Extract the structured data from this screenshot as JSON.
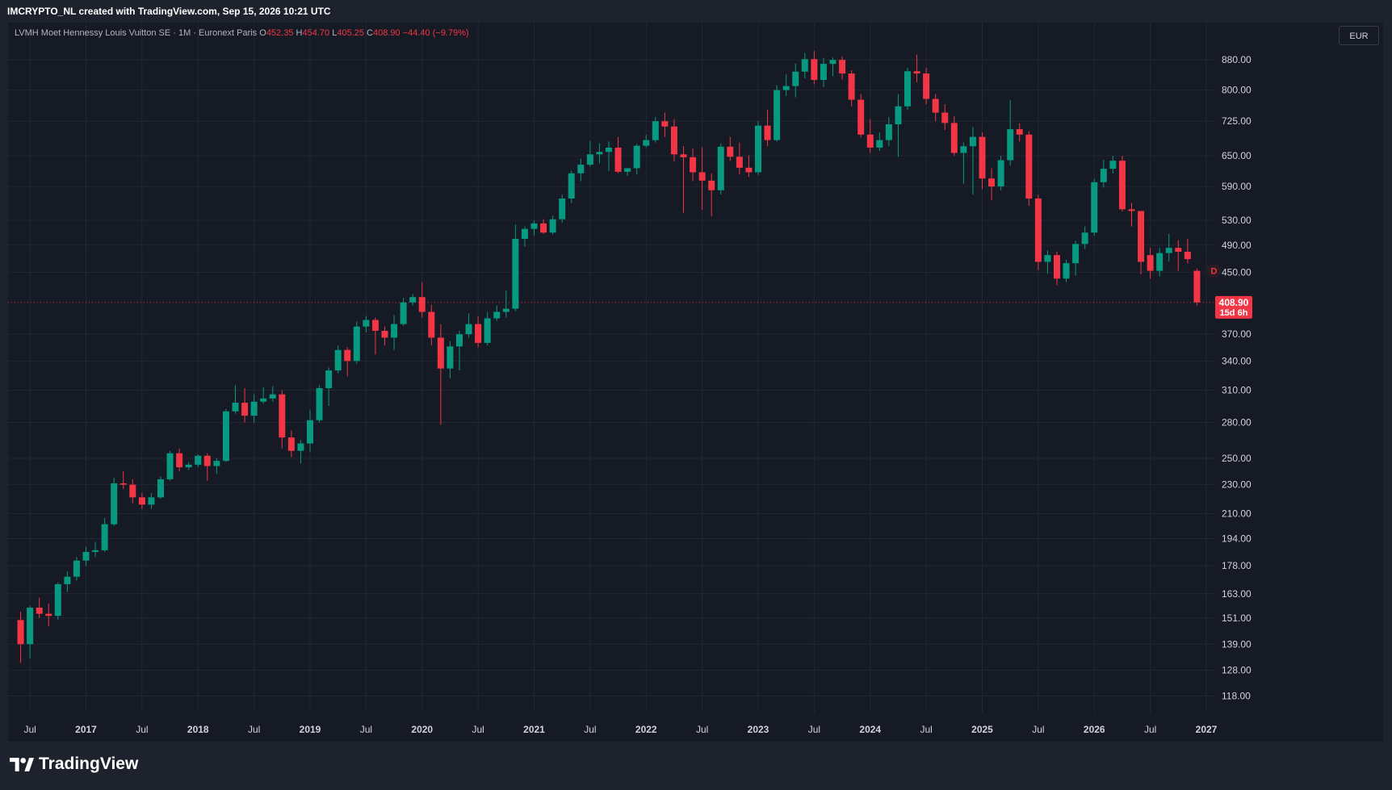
{
  "header": {
    "attribution": "IMCRYPTO_NL created with TradingView.com, Sep 15, 2026 10:21 UTC"
  },
  "legend": {
    "title": "LVMH Moet Hennessy Louis Vuitton SE · 1M · Euronext Paris",
    "o_label": "O",
    "o_value": "452.35",
    "h_label": "H",
    "h_value": "454.70",
    "l_label": "L",
    "l_value": "405.25",
    "c_label": "C",
    "c_value": "408.90",
    "change": "−44.40 (−9.79%)"
  },
  "currency_button": "EUR",
  "last_price": {
    "value": "408.90",
    "countdown": "15d 6h"
  },
  "event_marker": "D",
  "footer": {
    "logo_text": "TradingView"
  },
  "colors": {
    "up": "#089981",
    "down": "#f23645",
    "background": "#161a25",
    "grid": "#232733",
    "text": "#d1d4dc"
  },
  "chart_data": {
    "type": "candlestick",
    "title": "LVMH Moet Hennessy Louis Vuitton SE · 1M · Euronext Paris",
    "interval": "1M",
    "currency": "EUR",
    "y_scale": "log",
    "ylim": [
      112,
      990
    ],
    "x_range": [
      "2016-05",
      "2027-01"
    ],
    "y_ticks": [
      "880.00",
      "800.00",
      "725.00",
      "650.00",
      "590.00",
      "530.00",
      "490.00",
      "450.00",
      "370.00",
      "340.00",
      "310.00",
      "280.00",
      "250.00",
      "230.00",
      "210.00",
      "194.00",
      "178.00",
      "163.00",
      "151.00",
      "139.00",
      "128.00",
      "118.00"
    ],
    "x_ticks": [
      {
        "label": "Jul",
        "date": "2016-07"
      },
      {
        "label": "2017",
        "date": "2017-01"
      },
      {
        "label": "Jul",
        "date": "2017-07"
      },
      {
        "label": "2018",
        "date": "2018-01"
      },
      {
        "label": "Jul",
        "date": "2018-07"
      },
      {
        "label": "2019",
        "date": "2019-01"
      },
      {
        "label": "Jul",
        "date": "2019-07"
      },
      {
        "label": "2020",
        "date": "2020-01"
      },
      {
        "label": "Jul",
        "date": "2020-07"
      },
      {
        "label": "2021",
        "date": "2021-01"
      },
      {
        "label": "Jul",
        "date": "2021-07"
      },
      {
        "label": "2022",
        "date": "2022-01"
      },
      {
        "label": "Jul",
        "date": "2022-07"
      },
      {
        "label": "2023",
        "date": "2023-01"
      },
      {
        "label": "Jul",
        "date": "2023-07"
      },
      {
        "label": "2024",
        "date": "2024-01"
      },
      {
        "label": "Jul",
        "date": "2024-07"
      },
      {
        "label": "2025",
        "date": "2025-01"
      },
      {
        "label": "Jul",
        "date": "2025-07"
      },
      {
        "label": "2026",
        "date": "2026-01"
      },
      {
        "label": "Jul",
        "date": "2026-07"
      },
      {
        "label": "2027",
        "date": "2027-01"
      }
    ],
    "last_price": 408.9,
    "candles": [
      {
        "t": "2016-06",
        "o": 150,
        "h": 154,
        "l": 131,
        "c": 139
      },
      {
        "t": "2016-07",
        "o": 139,
        "h": 157,
        "l": 133,
        "c": 156
      },
      {
        "t": "2016-08",
        "o": 156,
        "h": 161,
        "l": 151,
        "c": 153
      },
      {
        "t": "2016-09",
        "o": 153,
        "h": 158,
        "l": 147,
        "c": 152
      },
      {
        "t": "2016-10",
        "o": 152,
        "h": 169,
        "l": 150,
        "c": 168
      },
      {
        "t": "2016-11",
        "o": 168,
        "h": 175,
        "l": 164,
        "c": 172
      },
      {
        "t": "2016-12",
        "o": 172,
        "h": 183,
        "l": 170,
        "c": 181
      },
      {
        "t": "2017-01",
        "o": 181,
        "h": 189,
        "l": 178,
        "c": 186
      },
      {
        "t": "2017-02",
        "o": 186,
        "h": 192,
        "l": 183,
        "c": 187
      },
      {
        "t": "2017-03",
        "o": 187,
        "h": 207,
        "l": 186,
        "c": 203
      },
      {
        "t": "2017-04",
        "o": 203,
        "h": 235,
        "l": 202,
        "c": 231
      },
      {
        "t": "2017-05",
        "o": 231,
        "h": 240,
        "l": 227,
        "c": 230
      },
      {
        "t": "2017-06",
        "o": 230,
        "h": 234,
        "l": 217,
        "c": 221
      },
      {
        "t": "2017-07",
        "o": 221,
        "h": 224,
        "l": 213,
        "c": 216
      },
      {
        "t": "2017-08",
        "o": 216,
        "h": 224,
        "l": 213,
        "c": 221
      },
      {
        "t": "2017-09",
        "o": 221,
        "h": 236,
        "l": 220,
        "c": 234
      },
      {
        "t": "2017-10",
        "o": 234,
        "h": 256,
        "l": 233,
        "c": 254
      },
      {
        "t": "2017-11",
        "o": 254,
        "h": 258,
        "l": 240,
        "c": 243
      },
      {
        "t": "2017-12",
        "o": 243,
        "h": 247,
        "l": 241,
        "c": 245
      },
      {
        "t": "2018-01",
        "o": 245,
        "h": 253,
        "l": 243,
        "c": 252
      },
      {
        "t": "2018-02",
        "o": 252,
        "h": 254,
        "l": 233,
        "c": 244
      },
      {
        "t": "2018-03",
        "o": 244,
        "h": 250,
        "l": 238,
        "c": 248
      },
      {
        "t": "2018-04",
        "o": 248,
        "h": 292,
        "l": 247,
        "c": 290
      },
      {
        "t": "2018-05",
        "o": 290,
        "h": 315,
        "l": 288,
        "c": 298
      },
      {
        "t": "2018-06",
        "o": 298,
        "h": 312,
        "l": 280,
        "c": 286
      },
      {
        "t": "2018-07",
        "o": 286,
        "h": 306,
        "l": 280,
        "c": 299
      },
      {
        "t": "2018-08",
        "o": 299,
        "h": 313,
        "l": 297,
        "c": 302
      },
      {
        "t": "2018-09",
        "o": 302,
        "h": 314,
        "l": 299,
        "c": 306
      },
      {
        "t": "2018-10",
        "o": 306,
        "h": 310,
        "l": 258,
        "c": 267
      },
      {
        "t": "2018-11",
        "o": 267,
        "h": 273,
        "l": 251,
        "c": 256
      },
      {
        "t": "2018-12",
        "o": 256,
        "h": 265,
        "l": 246,
        "c": 262
      },
      {
        "t": "2019-01",
        "o": 262,
        "h": 291,
        "l": 255,
        "c": 282
      },
      {
        "t": "2019-02",
        "o": 282,
        "h": 315,
        "l": 280,
        "c": 312
      },
      {
        "t": "2019-03",
        "o": 312,
        "h": 333,
        "l": 295,
        "c": 330
      },
      {
        "t": "2019-04",
        "o": 330,
        "h": 357,
        "l": 327,
        "c": 352
      },
      {
        "t": "2019-05",
        "o": 352,
        "h": 355,
        "l": 324,
        "c": 340
      },
      {
        "t": "2019-06",
        "o": 340,
        "h": 385,
        "l": 337,
        "c": 379
      },
      {
        "t": "2019-07",
        "o": 379,
        "h": 392,
        "l": 372,
        "c": 387
      },
      {
        "t": "2019-08",
        "o": 387,
        "h": 390,
        "l": 347,
        "c": 374
      },
      {
        "t": "2019-09",
        "o": 374,
        "h": 379,
        "l": 357,
        "c": 366
      },
      {
        "t": "2019-10",
        "o": 366,
        "h": 393,
        "l": 352,
        "c": 382
      },
      {
        "t": "2019-11",
        "o": 382,
        "h": 415,
        "l": 380,
        "c": 409
      },
      {
        "t": "2019-12",
        "o": 409,
        "h": 420,
        "l": 405,
        "c": 416
      },
      {
        "t": "2020-01",
        "o": 416,
        "h": 436,
        "l": 390,
        "c": 397
      },
      {
        "t": "2020-02",
        "o": 397,
        "h": 406,
        "l": 357,
        "c": 366
      },
      {
        "t": "2020-03",
        "o": 366,
        "h": 382,
        "l": 278,
        "c": 332
      },
      {
        "t": "2020-04",
        "o": 332,
        "h": 362,
        "l": 322,
        "c": 356
      },
      {
        "t": "2020-05",
        "o": 356,
        "h": 374,
        "l": 330,
        "c": 370
      },
      {
        "t": "2020-06",
        "o": 370,
        "h": 395,
        "l": 366,
        "c": 382
      },
      {
        "t": "2020-07",
        "o": 382,
        "h": 392,
        "l": 355,
        "c": 360
      },
      {
        "t": "2020-08",
        "o": 360,
        "h": 397,
        "l": 357,
        "c": 389
      },
      {
        "t": "2020-09",
        "o": 389,
        "h": 405,
        "l": 386,
        "c": 397
      },
      {
        "t": "2020-10",
        "o": 397,
        "h": 425,
        "l": 390,
        "c": 401
      },
      {
        "t": "2020-11",
        "o": 401,
        "h": 523,
        "l": 398,
        "c": 500
      },
      {
        "t": "2020-12",
        "o": 500,
        "h": 520,
        "l": 488,
        "c": 516
      },
      {
        "t": "2021-01",
        "o": 516,
        "h": 530,
        "l": 505,
        "c": 525
      },
      {
        "t": "2021-02",
        "o": 525,
        "h": 532,
        "l": 508,
        "c": 510
      },
      {
        "t": "2021-03",
        "o": 510,
        "h": 538,
        "l": 507,
        "c": 532
      },
      {
        "t": "2021-04",
        "o": 532,
        "h": 575,
        "l": 526,
        "c": 568
      },
      {
        "t": "2021-05",
        "o": 568,
        "h": 620,
        "l": 560,
        "c": 615
      },
      {
        "t": "2021-06",
        "o": 615,
        "h": 644,
        "l": 600,
        "c": 632
      },
      {
        "t": "2021-07",
        "o": 632,
        "h": 681,
        "l": 628,
        "c": 653
      },
      {
        "t": "2021-08",
        "o": 653,
        "h": 676,
        "l": 635,
        "c": 658
      },
      {
        "t": "2021-09",
        "o": 658,
        "h": 680,
        "l": 620,
        "c": 667
      },
      {
        "t": "2021-10",
        "o": 667,
        "h": 690,
        "l": 615,
        "c": 618
      },
      {
        "t": "2021-11",
        "o": 618,
        "h": 625,
        "l": 610,
        "c": 625
      },
      {
        "t": "2021-12",
        "o": 625,
        "h": 675,
        "l": 613,
        "c": 671
      },
      {
        "t": "2022-01",
        "o": 671,
        "h": 695,
        "l": 667,
        "c": 683
      },
      {
        "t": "2022-02",
        "o": 683,
        "h": 735,
        "l": 678,
        "c": 725
      },
      {
        "t": "2022-03",
        "o": 725,
        "h": 745,
        "l": 690,
        "c": 713
      },
      {
        "t": "2022-04",
        "o": 713,
        "h": 730,
        "l": 638,
        "c": 653
      },
      {
        "t": "2022-05",
        "o": 653,
        "h": 670,
        "l": 543,
        "c": 647
      },
      {
        "t": "2022-06",
        "o": 647,
        "h": 665,
        "l": 600,
        "c": 617
      },
      {
        "t": "2022-07",
        "o": 617,
        "h": 668,
        "l": 548,
        "c": 601
      },
      {
        "t": "2022-08",
        "o": 601,
        "h": 615,
        "l": 537,
        "c": 583
      },
      {
        "t": "2022-09",
        "o": 583,
        "h": 676,
        "l": 575,
        "c": 669
      },
      {
        "t": "2022-10",
        "o": 669,
        "h": 690,
        "l": 640,
        "c": 648
      },
      {
        "t": "2022-11",
        "o": 648,
        "h": 678,
        "l": 613,
        "c": 626
      },
      {
        "t": "2022-12",
        "o": 626,
        "h": 651,
        "l": 608,
        "c": 617
      },
      {
        "t": "2023-01",
        "o": 617,
        "h": 725,
        "l": 612,
        "c": 715
      },
      {
        "t": "2023-02",
        "o": 715,
        "h": 752,
        "l": 670,
        "c": 683
      },
      {
        "t": "2023-03",
        "o": 683,
        "h": 812,
        "l": 680,
        "c": 800
      },
      {
        "t": "2023-04",
        "o": 800,
        "h": 840,
        "l": 785,
        "c": 810
      },
      {
        "t": "2023-05",
        "o": 810,
        "h": 870,
        "l": 782,
        "c": 848
      },
      {
        "t": "2023-06",
        "o": 848,
        "h": 900,
        "l": 830,
        "c": 882
      },
      {
        "t": "2023-07",
        "o": 882,
        "h": 905,
        "l": 815,
        "c": 826
      },
      {
        "t": "2023-08",
        "o": 826,
        "h": 885,
        "l": 808,
        "c": 869
      },
      {
        "t": "2023-09",
        "o": 869,
        "h": 886,
        "l": 836,
        "c": 880
      },
      {
        "t": "2023-10",
        "o": 880,
        "h": 890,
        "l": 827,
        "c": 843
      },
      {
        "t": "2023-11",
        "o": 843,
        "h": 852,
        "l": 760,
        "c": 776
      },
      {
        "t": "2023-12",
        "o": 776,
        "h": 790,
        "l": 689,
        "c": 695
      },
      {
        "t": "2024-01",
        "o": 695,
        "h": 730,
        "l": 656,
        "c": 667
      },
      {
        "t": "2024-02",
        "o": 667,
        "h": 700,
        "l": 660,
        "c": 683
      },
      {
        "t": "2024-03",
        "o": 683,
        "h": 735,
        "l": 670,
        "c": 718
      },
      {
        "t": "2024-04",
        "o": 718,
        "h": 790,
        "l": 648,
        "c": 760
      },
      {
        "t": "2024-05",
        "o": 760,
        "h": 858,
        "l": 752,
        "c": 849
      },
      {
        "t": "2024-06",
        "o": 849,
        "h": 895,
        "l": 820,
        "c": 843
      },
      {
        "t": "2024-07",
        "o": 843,
        "h": 858,
        "l": 765,
        "c": 778
      },
      {
        "t": "2024-08",
        "o": 778,
        "h": 790,
        "l": 725,
        "c": 745
      },
      {
        "t": "2024-09",
        "o": 745,
        "h": 765,
        "l": 705,
        "c": 721
      },
      {
        "t": "2024-10",
        "o": 721,
        "h": 737,
        "l": 650,
        "c": 656
      },
      {
        "t": "2024-11",
        "o": 656,
        "h": 678,
        "l": 595,
        "c": 670
      },
      {
        "t": "2024-12",
        "o": 670,
        "h": 712,
        "l": 575,
        "c": 690
      },
      {
        "t": "2025-01",
        "o": 690,
        "h": 700,
        "l": 585,
        "c": 605
      },
      {
        "t": "2025-02",
        "o": 605,
        "h": 625,
        "l": 565,
        "c": 590
      },
      {
        "t": "2025-03",
        "o": 590,
        "h": 650,
        "l": 583,
        "c": 641
      },
      {
        "t": "2025-04",
        "o": 641,
        "h": 775,
        "l": 630,
        "c": 707
      },
      {
        "t": "2025-05",
        "o": 707,
        "h": 720,
        "l": 680,
        "c": 695
      },
      {
        "t": "2025-06",
        "o": 695,
        "h": 703,
        "l": 555,
        "c": 568
      },
      {
        "t": "2025-07",
        "o": 568,
        "h": 575,
        "l": 453,
        "c": 465
      },
      {
        "t": "2025-08",
        "o": 465,
        "h": 482,
        "l": 448,
        "c": 475
      },
      {
        "t": "2025-09",
        "o": 475,
        "h": 480,
        "l": 432,
        "c": 441
      },
      {
        "t": "2025-10",
        "o": 441,
        "h": 468,
        "l": 436,
        "c": 463
      },
      {
        "t": "2025-11",
        "o": 463,
        "h": 497,
        "l": 445,
        "c": 492
      },
      {
        "t": "2025-12",
        "o": 492,
        "h": 520,
        "l": 484,
        "c": 510
      },
      {
        "t": "2026-01",
        "o": 510,
        "h": 605,
        "l": 505,
        "c": 598
      },
      {
        "t": "2026-02",
        "o": 598,
        "h": 642,
        "l": 588,
        "c": 624
      },
      {
        "t": "2026-03",
        "o": 624,
        "h": 650,
        "l": 615,
        "c": 640
      },
      {
        "t": "2026-04",
        "o": 640,
        "h": 650,
        "l": 545,
        "c": 549
      },
      {
        "t": "2026-05",
        "o": 549,
        "h": 560,
        "l": 520,
        "c": 546
      },
      {
        "t": "2026-06",
        "o": 546,
        "h": 513,
        "l": 447,
        "c": 465
      },
      {
        "t": "2026-07",
        "o": 475,
        "h": 486,
        "l": 441,
        "c": 452
      },
      {
        "t": "2026-08",
        "o": 452,
        "h": 486,
        "l": 444,
        "c": 478
      },
      {
        "t": "2026-09",
        "o": 478,
        "h": 508,
        "l": 465,
        "c": 486
      },
      {
        "t": "2026-10",
        "o": 486,
        "h": 498,
        "l": 452,
        "c": 480
      },
      {
        "t": "2026-11",
        "o": 480,
        "h": 500,
        "l": 463,
        "c": 469
      },
      {
        "t": "2026-12",
        "o": 452,
        "h": 455,
        "l": 405,
        "c": 409
      }
    ]
  }
}
